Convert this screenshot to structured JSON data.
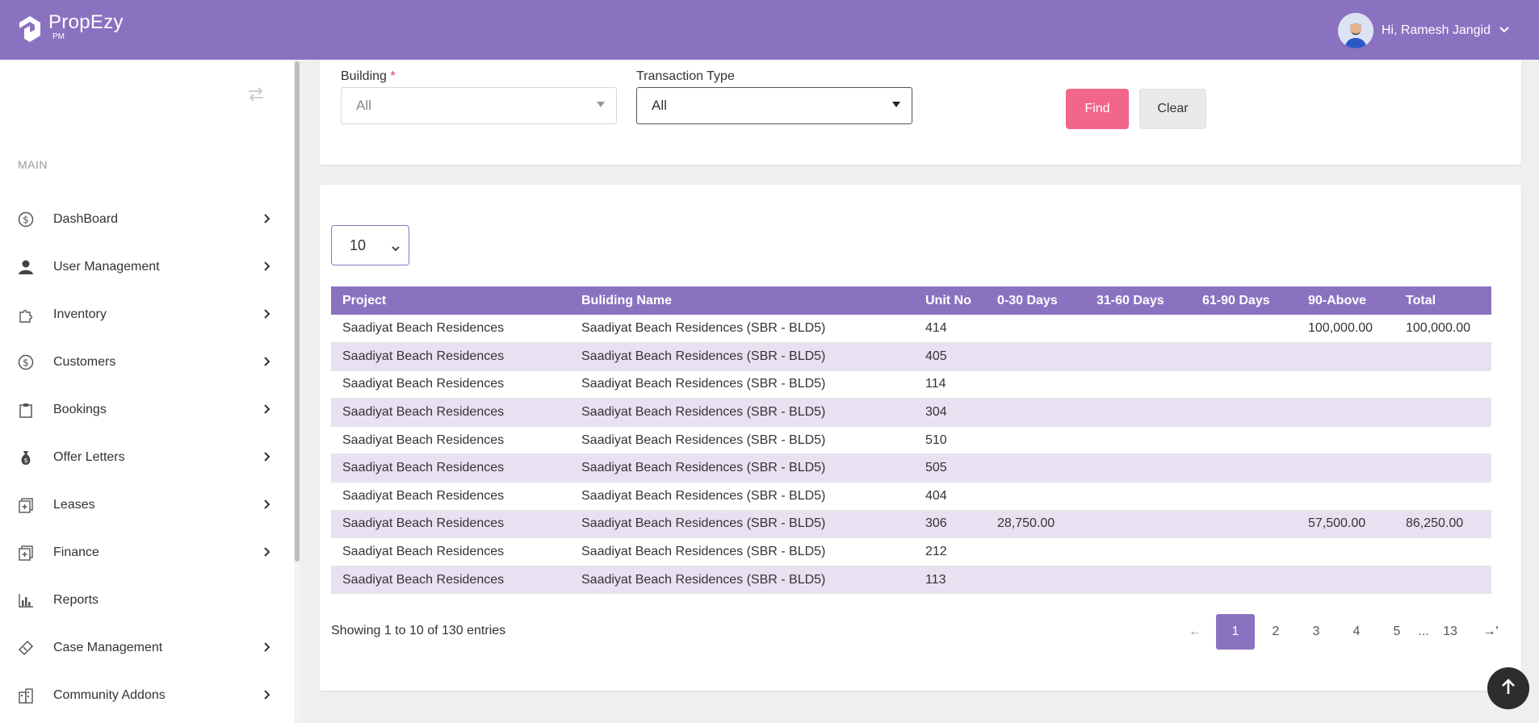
{
  "app": {
    "brand": "PropEzy",
    "brand_sub": "PM",
    "greeting": "Hi, Ramesh Jangid"
  },
  "sidebar": {
    "section_label": "MAIN",
    "items": [
      {
        "label": "DashBoard",
        "icon": "dollar-circle-icon",
        "has_arrow": true
      },
      {
        "label": "User Management",
        "icon": "user-icon",
        "has_arrow": true
      },
      {
        "label": "Inventory",
        "icon": "puzzle-icon",
        "has_arrow": true
      },
      {
        "label": "Customers",
        "icon": "dollar-circle-icon",
        "has_arrow": true
      },
      {
        "label": "Bookings",
        "icon": "clipboard-icon",
        "has_arrow": true
      },
      {
        "label": "Offer Letters",
        "icon": "money-bag-icon",
        "has_arrow": true
      },
      {
        "label": "Leases",
        "icon": "document-plus-icon",
        "has_arrow": true
      },
      {
        "label": "Finance",
        "icon": "document-plus-icon",
        "has_arrow": true
      },
      {
        "label": "Reports",
        "icon": "bar-chart-icon",
        "has_arrow": false
      },
      {
        "label": "Case Management",
        "icon": "ticket-icon",
        "has_arrow": true
      },
      {
        "label": "Community Addons",
        "icon": "buildings-icon",
        "has_arrow": true
      }
    ]
  },
  "filters": {
    "building_label": "Building",
    "building_required": "*",
    "building_value": "All",
    "transaction_type_label": "Transaction Type",
    "transaction_type_value": "All",
    "find_label": "Find",
    "clear_label": "Clear"
  },
  "table": {
    "page_size": "10",
    "columns": [
      "Project",
      "Buliding Name",
      "Unit No",
      "0-30 Days",
      "31-60 Days",
      "61-90 Days",
      "90-Above",
      "Total"
    ],
    "rows": [
      [
        "Saadiyat Beach Residences",
        "Saadiyat Beach Residences (SBR - BLD5)",
        "414",
        "",
        "",
        "",
        "100,000.00",
        "100,000.00"
      ],
      [
        "Saadiyat Beach Residences",
        "Saadiyat Beach Residences (SBR - BLD5)",
        "405",
        "",
        "",
        "",
        "",
        ""
      ],
      [
        "Saadiyat Beach Residences",
        "Saadiyat Beach Residences (SBR - BLD5)",
        "114",
        "",
        "",
        "",
        "",
        ""
      ],
      [
        "Saadiyat Beach Residences",
        "Saadiyat Beach Residences (SBR - BLD5)",
        "304",
        "",
        "",
        "",
        "",
        ""
      ],
      [
        "Saadiyat Beach Residences",
        "Saadiyat Beach Residences (SBR - BLD5)",
        "510",
        "",
        "",
        "",
        "",
        ""
      ],
      [
        "Saadiyat Beach Residences",
        "Saadiyat Beach Residences (SBR - BLD5)",
        "505",
        "",
        "",
        "",
        "",
        ""
      ],
      [
        "Saadiyat Beach Residences",
        "Saadiyat Beach Residences (SBR - BLD5)",
        "404",
        "",
        "",
        "",
        "",
        ""
      ],
      [
        "Saadiyat Beach Residences",
        "Saadiyat Beach Residences (SBR - BLD5)",
        "306",
        "28,750.00",
        "",
        "",
        "57,500.00",
        "86,250.00"
      ],
      [
        "Saadiyat Beach Residences",
        "Saadiyat Beach Residences (SBR - BLD5)",
        "212",
        "",
        "",
        "",
        "",
        ""
      ],
      [
        "Saadiyat Beach Residences",
        "Saadiyat Beach Residences (SBR - BLD5)",
        "113",
        "",
        "",
        "",
        "",
        ""
      ]
    ],
    "info": "Showing 1 to 10 of 130 entries",
    "pagination": {
      "prev": "←",
      "pages": [
        "1",
        "2",
        "3",
        "4",
        "5"
      ],
      "ellipsis": "...",
      "last": "13",
      "next": "→'",
      "active": "1"
    }
  },
  "colors": {
    "primary": "#8b72c1",
    "find": "#f2668b",
    "row_alt": "#e8e1f1"
  }
}
